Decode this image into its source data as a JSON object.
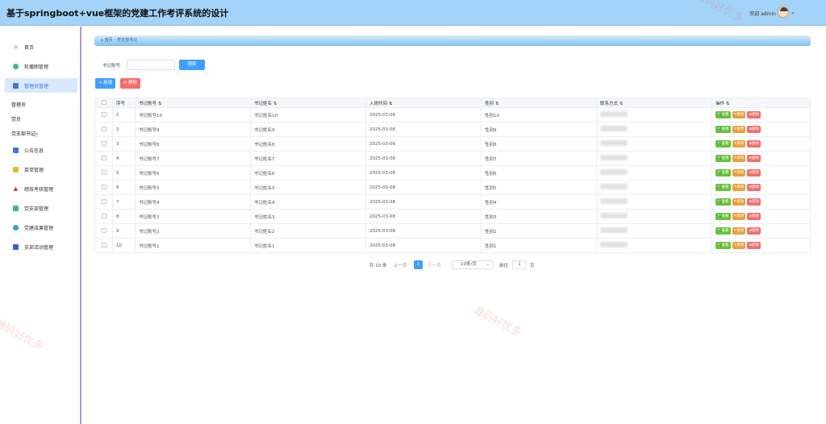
{
  "header": {
    "title": "基于springboot+vue框架的党建工作考评系统的设计",
    "welcome": "欢迎 admin",
    "user_menu_icon": "chevron-down-icon"
  },
  "sidebar": {
    "items": [
      {
        "label": "首页",
        "icon": "home-icon"
      },
      {
        "label": "轮播图管理",
        "icon": "carousel-icon"
      },
      {
        "label": "管理员管理",
        "icon": "admin-icon"
      }
    ],
    "sub_items": [
      "管理员",
      "党员",
      "党支部书记"
    ],
    "more_items": [
      {
        "label": "公告信息",
        "icon": "notice-icon"
      },
      {
        "label": "菜单管理",
        "icon": "menu-icon"
      },
      {
        "label": "绩效考核管理",
        "icon": "performance-icon"
      },
      {
        "label": "党支部管理",
        "icon": "branch-icon"
      },
      {
        "label": "党建成果管理",
        "icon": "achievement-icon"
      },
      {
        "label": "支部活动管理",
        "icon": "activity-icon"
      }
    ]
  },
  "breadcrumb": {
    "home": "首页",
    "separator": "›",
    "current": "党支部书记"
  },
  "search": {
    "label": "书记账号:",
    "value": "",
    "placeholder": "",
    "button": "搜索"
  },
  "toolbar": {
    "add": "+ 新增",
    "delete": "⊖ 删除"
  },
  "table": {
    "columns": [
      "序号",
      "书记账号 ⇅",
      "书记姓名 ⇅",
      "入党时间 ⇅",
      "性别 ⇅",
      "联系方式 ⇅",
      "操作 ⇅"
    ],
    "rows": [
      {
        "index": "1",
        "account": "书记账号10",
        "name": "书记姓名10",
        "date": "2025-03-08",
        "gender": "性别10"
      },
      {
        "index": "2",
        "account": "书记账号9",
        "name": "书记姓名9",
        "date": "2025-03-08",
        "gender": "性别9"
      },
      {
        "index": "3",
        "account": "书记账号8",
        "name": "书记姓名8",
        "date": "2025-03-08",
        "gender": "性别8"
      },
      {
        "index": "4",
        "account": "书记账号7",
        "name": "书记姓名7",
        "date": "2025-03-08",
        "gender": "性别7"
      },
      {
        "index": "5",
        "account": "书记账号6",
        "name": "书记姓名6",
        "date": "2025-03-08",
        "gender": "性别6"
      },
      {
        "index": "6",
        "account": "书记账号5",
        "name": "书记姓名5",
        "date": "2025-03-08",
        "gender": "性别5"
      },
      {
        "index": "7",
        "account": "书记账号4",
        "name": "书记姓名4",
        "date": "2025-03-08",
        "gender": "性别4"
      },
      {
        "index": "8",
        "account": "书记账号3",
        "name": "书记姓名3",
        "date": "2025-03-08",
        "gender": "性别3"
      },
      {
        "index": "9",
        "account": "书记账号2",
        "name": "书记姓名2",
        "date": "2025-03-08",
        "gender": "性别2"
      },
      {
        "index": "10",
        "account": "书记账号1",
        "name": "书记姓名1",
        "date": "2025-03-08",
        "gender": "性别1"
      }
    ],
    "actions": {
      "view": "查看",
      "edit": "修改",
      "delete": "删除"
    }
  },
  "pagination": {
    "total": "共 10 条",
    "prev": "上一页",
    "current": "1",
    "next": "下一页",
    "page_size": "10条/页",
    "goto_label": "前往",
    "goto_value": "1",
    "goto_suffix": "页"
  },
  "watermark": "源码好优多",
  "colors": {
    "header": "#a3d3f8",
    "primary": "#409eff",
    "danger": "#f56c6c",
    "success": "#67c23a",
    "warning": "#e6a23c"
  }
}
